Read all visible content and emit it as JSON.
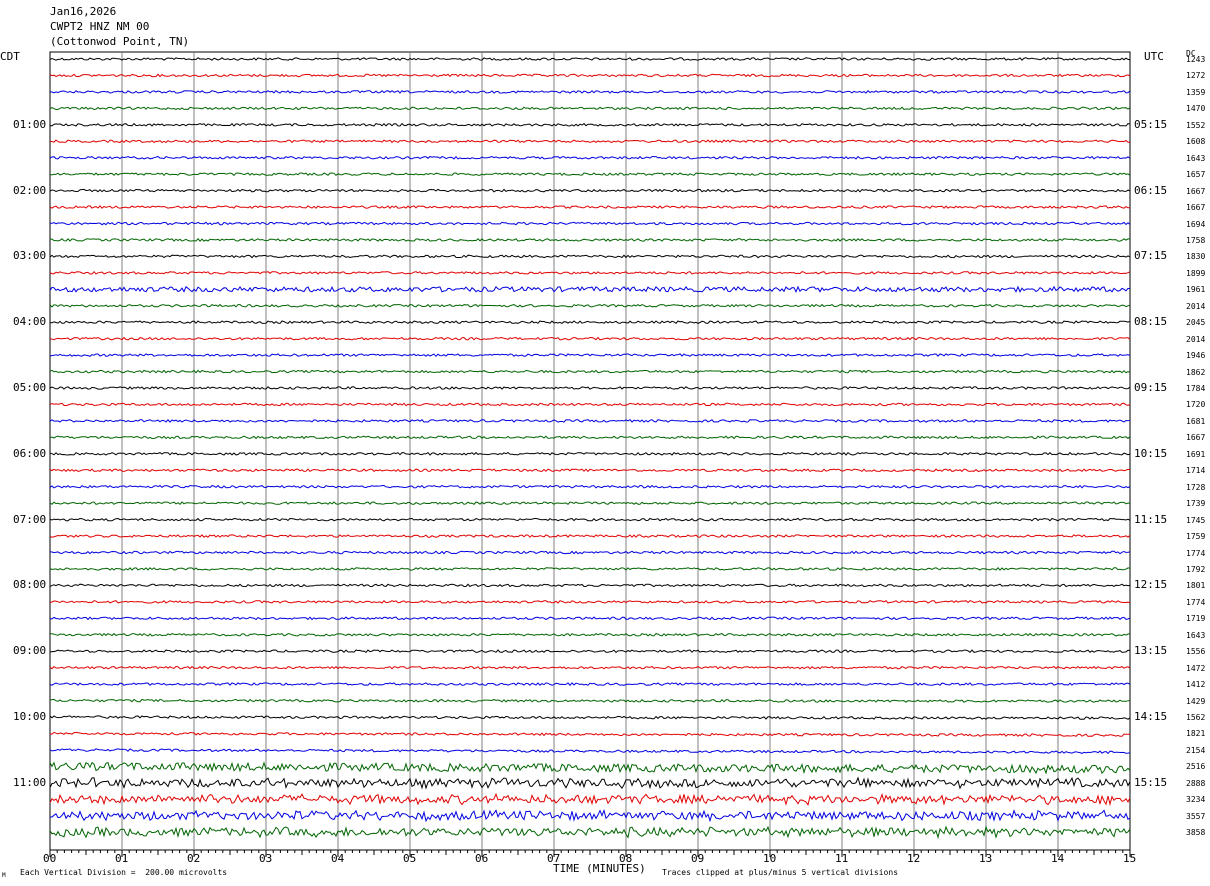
{
  "header": {
    "date": "Jan16,2026",
    "station": "CWPT2 HNZ NM 00",
    "location": "(Cottonwod Point, TN)"
  },
  "left_zone": "CDT",
  "right_zone": "UTC",
  "dc_header": "DC",
  "footer": {
    "vertical_division": "Each Vertical Division =  200.00 microvolts",
    "clip_note": "Traces clipped at plus/minus 5 vertical divisions",
    "corner_mark": "M"
  },
  "colors": {
    "trace_cycle": [
      "#000000",
      "#e00000",
      "#0000e0",
      "#006400"
    ],
    "grid": "#808080"
  },
  "chart_data": {
    "type": "line",
    "title": "",
    "xlabel": "TIME (MINUTES)",
    "x_ticks": [
      "00",
      "01",
      "02",
      "03",
      "04",
      "05",
      "06",
      "07",
      "08",
      "09",
      "10",
      "11",
      "12",
      "13",
      "14",
      "15"
    ],
    "xlim": [
      0,
      15
    ],
    "trace_count": 48,
    "left_hour_labels": [
      "01:00",
      "02:00",
      "03:00",
      "04:00",
      "05:00",
      "06:00",
      "07:00",
      "08:00",
      "09:00",
      "10:00",
      "11:00"
    ],
    "right_hour_labels": [
      "05:15",
      "06:15",
      "07:15",
      "08:15",
      "09:15",
      "10:15",
      "11:15",
      "12:15",
      "13:15",
      "14:15",
      "15:15"
    ],
    "dc_offsets": [
      1243,
      1272,
      1359,
      1470,
      1552,
      1608,
      1643,
      1657,
      1667,
      1667,
      1694,
      1758,
      1830,
      1899,
      1961,
      2014,
      2045,
      2014,
      1946,
      1862,
      1784,
      1720,
      1681,
      1667,
      1691,
      1714,
      1728,
      1739,
      1745,
      1759,
      1774,
      1792,
      1801,
      1774,
      1719,
      1643,
      1556,
      1472,
      1412,
      1429,
      1562,
      1821,
      2154,
      2516,
      2888,
      3234,
      3557,
      3858
    ],
    "grid": true
  }
}
